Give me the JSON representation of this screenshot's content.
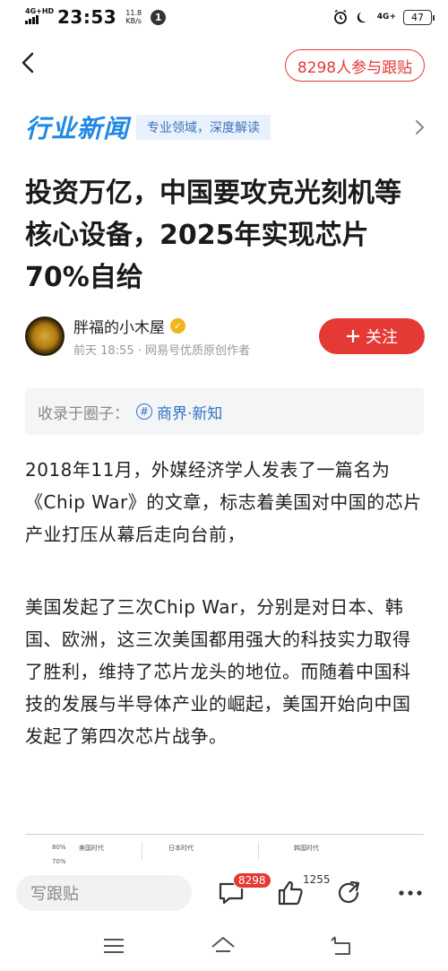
{
  "status_bar": {
    "network": "4G+HD",
    "time": "23:53",
    "speed_value": "11.8",
    "speed_unit": "KB/s",
    "notification_count": "1",
    "network_right": "4G+",
    "battery": "47"
  },
  "top_bar": {
    "follow_count_label": "8298人参与跟贴"
  },
  "channel": {
    "title": "行业新闻",
    "subtitle": "专业领域，深度解读"
  },
  "article": {
    "headline": "投资万亿，中国要攻克光刻机等核心设备，2025年实现芯片70%自给",
    "author": "胖福的小木屋",
    "time": "前天 18:55",
    "source": "网易号优质原创作者",
    "follow_label": "关注",
    "circle_label": "收录于圈子：",
    "circle_name": "商界·新知",
    "paragraphs": [
      "2018年11月，外媒经济学人发表了一篇名为《Chip War》的文章，标志着美国对中国的芯片产业打压从幕后走向台前，",
      "美国发起了三次Chip War，分别是对日本、韩国、欧洲，这三次美国都用强大的科技实力取得了胜利，维持了芯片龙头的地位。而随着中国科技的发展与半导体产业的崛起，美国开始向中国发起了第四次芯片战争。"
    ],
    "image_labels": [
      "80%",
      "70%",
      "美国时代",
      "日本时代",
      "韩国时代"
    ]
  },
  "action_bar": {
    "reply_placeholder": "写跟贴",
    "comment_count": "8298",
    "like_count": "1255"
  },
  "colors": {
    "accent_red": "#e53935",
    "channel_blue": "#1e88e5",
    "link_blue": "#3373c4"
  }
}
